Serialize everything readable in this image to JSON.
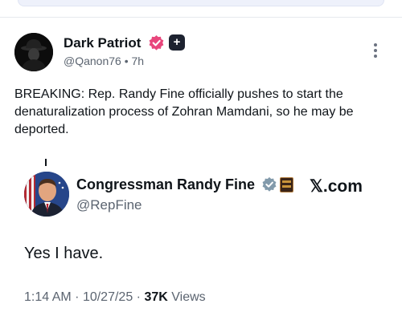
{
  "post": {
    "author_name": "Dark Patriot",
    "handle": "@Qanon76",
    "separator": "•",
    "age": "7h",
    "text": "BREAKING: Rep. Randy Fine officially pushes to start the denaturalization process of Zohran Mamdani, so he may be deported.",
    "verified_color": "#e8467c"
  },
  "quoted": {
    "name": "Congressman Randy Fine",
    "handle": "@RepFine",
    "site_logo": "𝕏.com",
    "text": "Yes I have.",
    "time": "1:14 AM",
    "dot1": "·",
    "date": "10/27/25",
    "dot2": "·",
    "views_count": "37K",
    "views_label": "Views",
    "verified_color": "#829aab"
  }
}
